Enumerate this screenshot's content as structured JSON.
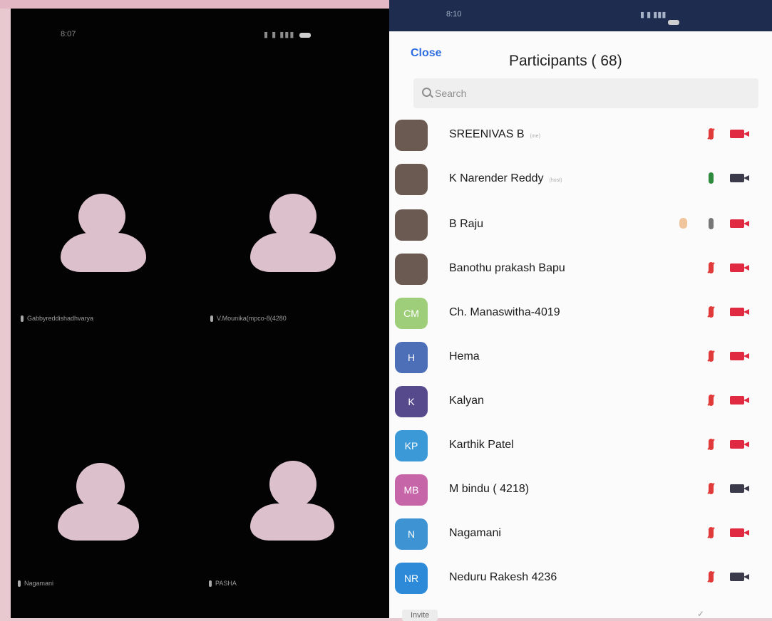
{
  "left_screen": {
    "status_time": "8:07",
    "tiles": [
      {
        "name": "Gabbyreddishadhvarya"
      },
      {
        "name": "V.Mounika(mpco-8(4280"
      },
      {
        "name": "Nagamani"
      },
      {
        "name": "PASHA"
      }
    ]
  },
  "right_screen": {
    "status_time": "8:10",
    "close_label": "Close",
    "title": "Participants ( 68)",
    "search_placeholder": "Search",
    "participants": [
      {
        "name": "SREENIVAS B",
        "tag": "(me)",
        "initials": "",
        "color": "photo",
        "mic": "muted",
        "cam": "off",
        "hand": false
      },
      {
        "name": "K Narender Reddy",
        "tag": "(host)",
        "initials": "",
        "color": "photo",
        "mic": "on",
        "cam": "on",
        "hand": false
      },
      {
        "name": "B Raju",
        "tag": "",
        "initials": "",
        "color": "photo",
        "mic": "grey",
        "cam": "off",
        "hand": true
      },
      {
        "name": "Banothu prakash Bapu",
        "tag": "",
        "initials": "",
        "color": "photo",
        "mic": "muted",
        "cam": "off",
        "hand": false
      },
      {
        "name": "Ch. Manaswitha-4019",
        "tag": "",
        "initials": "CM",
        "color": "#9fce7a",
        "mic": "muted",
        "cam": "off",
        "hand": false
      },
      {
        "name": "Hema",
        "tag": "",
        "initials": "H",
        "color": "#4c6fb8",
        "mic": "muted",
        "cam": "off",
        "hand": false
      },
      {
        "name": "Kalyan",
        "tag": "",
        "initials": "K",
        "color": "#564a8c",
        "mic": "muted",
        "cam": "off",
        "hand": false
      },
      {
        "name": "Karthik Patel",
        "tag": "",
        "initials": "KP",
        "color": "#3b99d8",
        "mic": "muted",
        "cam": "off",
        "hand": false
      },
      {
        "name": "M bindu ( 4218)",
        "tag": "",
        "initials": "MB",
        "color": "#c666a8",
        "mic": "muted",
        "cam": "on",
        "hand": false
      },
      {
        "name": "Nagamani",
        "tag": "",
        "initials": "N",
        "color": "#3e93d3",
        "mic": "muted",
        "cam": "off",
        "hand": false
      },
      {
        "name": "Neduru Rakesh 4236",
        "tag": "",
        "initials": "NR",
        "color": "#2c8ad8",
        "mic": "muted",
        "cam": "on",
        "hand": false
      }
    ],
    "invite_label": "Invite"
  }
}
